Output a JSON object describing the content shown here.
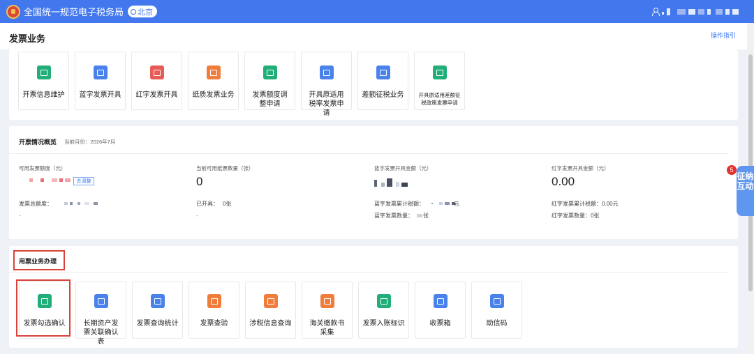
{
  "header": {
    "app_title": "全国统一规范电子税务局",
    "region": "北京"
  },
  "page": {
    "title": "发票业务",
    "help_link": "操作指引"
  },
  "top_tiles": [
    {
      "label": "开票信息维护",
      "icon": "invoice-info-icon",
      "color": "#21ae78"
    },
    {
      "label": "蓝字发票开具",
      "icon": "blue-invoice-icon",
      "color": "#4982ea"
    },
    {
      "label": "红字发票开具",
      "icon": "red-invoice-icon",
      "color": "#e85a56"
    },
    {
      "label": "纸质发票业务",
      "icon": "paper-invoice-icon",
      "color": "#f07d3c"
    },
    {
      "label": "发票额度调整申请",
      "icon": "quota-adjust-icon",
      "color": "#21ae78"
    },
    {
      "label": "开具原适用税率发票申请",
      "icon": "original-rate-icon",
      "color": "#4982ea"
    },
    {
      "label": "差额征税业务",
      "icon": "differential-tax-icon",
      "color": "#4982ea"
    },
    {
      "label": "开具原适用差额征税政策发票申请",
      "icon": "differential-policy-icon",
      "color": "#21ae78"
    }
  ],
  "overview": {
    "title": "开票情况概览",
    "month": "当前月份：2026年7月",
    "col1": {
      "label": "可用发票额度（元）",
      "button": "去调整",
      "total_label": "发票总额度：",
      "dash": "-"
    },
    "col2": {
      "label": "当前可用纸票数量（张）",
      "value": "0",
      "issued_label": "已开具：",
      "issued_value": "0张",
      "dash": "-"
    },
    "col3": {
      "label": "蓝字发票开具金额（元）",
      "tax_label": "蓝字发票累计税额：",
      "tax_suffix": "元",
      "count_label": "蓝字发票数量：",
      "count_suffix": "张"
    },
    "col4": {
      "label": "红字发票开具金额（元）",
      "value": "0.00",
      "tax_line": "红字发票累计税额：0.00元",
      "count_line": "红字发票数量：0张"
    }
  },
  "business": {
    "title": "用票业务办理",
    "tiles": [
      {
        "label": "发票勾选确认",
        "icon": "invoice-check-icon",
        "color": "#21ae78"
      },
      {
        "label": "长期资产发票关联确认表",
        "icon": "long-term-asset-icon",
        "color": "#4982ea"
      },
      {
        "label": "发票查询统计",
        "icon": "invoice-query-icon",
        "color": "#4982ea"
      },
      {
        "label": "发票查验",
        "icon": "invoice-verify-icon",
        "color": "#f07d3c"
      },
      {
        "label": "涉税信息查询",
        "icon": "tax-info-query-icon",
        "color": "#f07d3c"
      },
      {
        "label": "海关缴款书采集",
        "icon": "customs-payment-icon",
        "color": "#f07d3c"
      },
      {
        "label": "发票入账标识",
        "icon": "accounting-mark-icon",
        "color": "#21ae78"
      },
      {
        "label": "收票箱",
        "icon": "inbox-icon",
        "color": "#4982ea"
      },
      {
        "label": "助信码",
        "icon": "qr-code-icon",
        "color": "#4982ea"
      }
    ]
  },
  "float_tab": {
    "label": "征纳互动",
    "badge": "5"
  }
}
